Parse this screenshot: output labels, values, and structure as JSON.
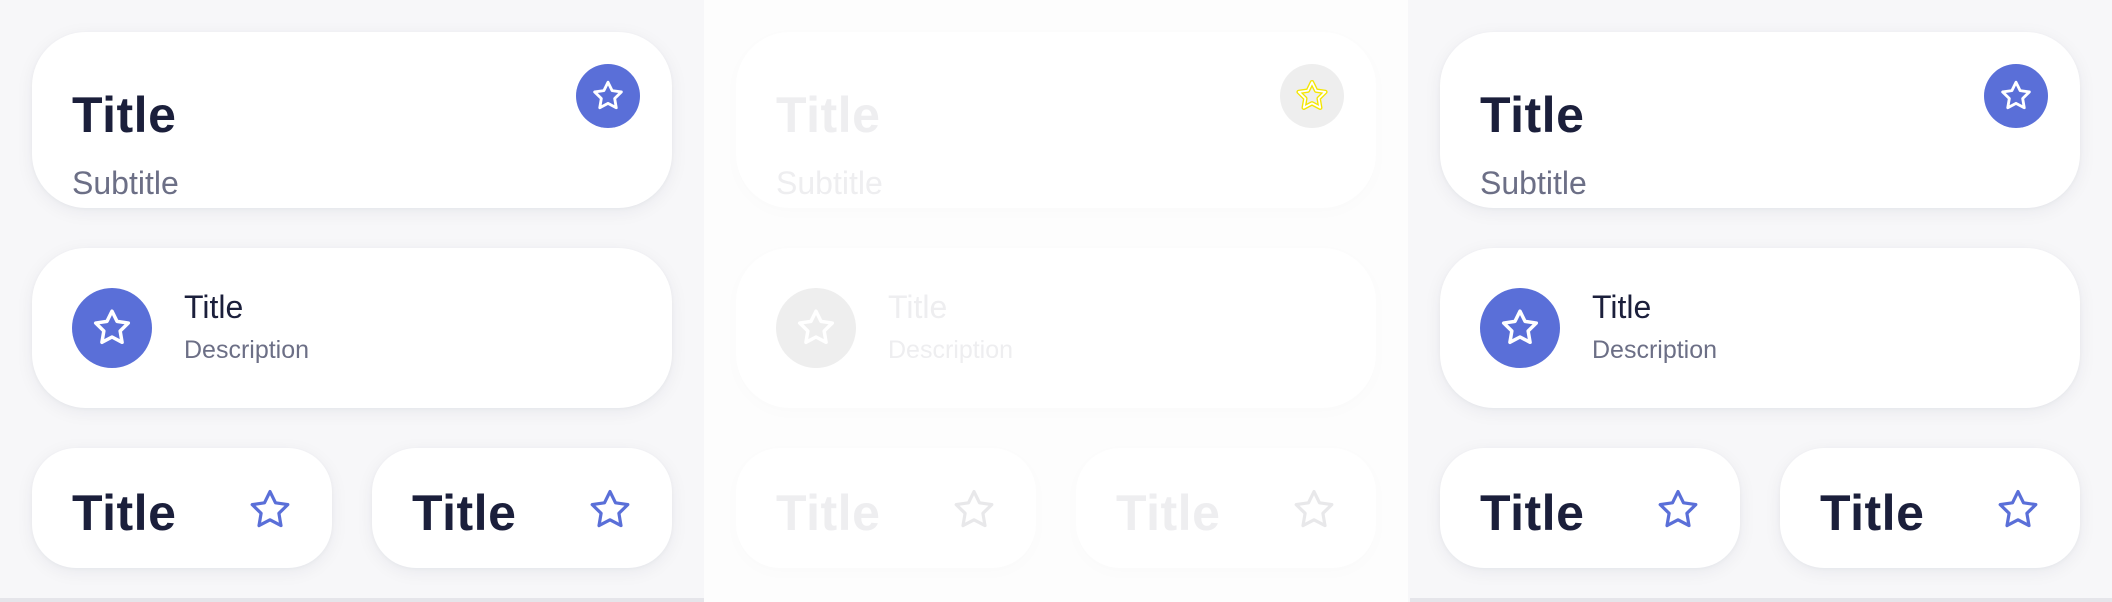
{
  "colors": {
    "accent": "#5a6fd8",
    "title": "#1b1f3b",
    "subtitle": "#6c6f86",
    "disabled_text": "#eeeef0",
    "disabled_icon_bg": "#eeeeee",
    "disabled_icon": "#e8e8ea",
    "hover_star_outline": "#f4e600"
  },
  "icons": {
    "favorite": "star-icon"
  },
  "panels": [
    {
      "state": "enabled",
      "large_card": {
        "title": "Title",
        "subtitle": "Subtitle"
      },
      "list_card": {
        "title": "Title",
        "description": "Description"
      },
      "small_cards": [
        {
          "title": "Title"
        },
        {
          "title": "Title"
        }
      ]
    },
    {
      "state": "disabled",
      "large_card": {
        "title": "Title",
        "subtitle": "Subtitle"
      },
      "list_card": {
        "title": "Title",
        "description": "Description"
      },
      "small_cards": [
        {
          "title": "Title"
        },
        {
          "title": "Title"
        }
      ]
    },
    {
      "state": "enabled",
      "large_card": {
        "title": "Title",
        "subtitle": "Subtitle"
      },
      "list_card": {
        "title": "Title",
        "description": "Description"
      },
      "small_cards": [
        {
          "title": "Title"
        },
        {
          "title": "Title"
        }
      ]
    }
  ]
}
